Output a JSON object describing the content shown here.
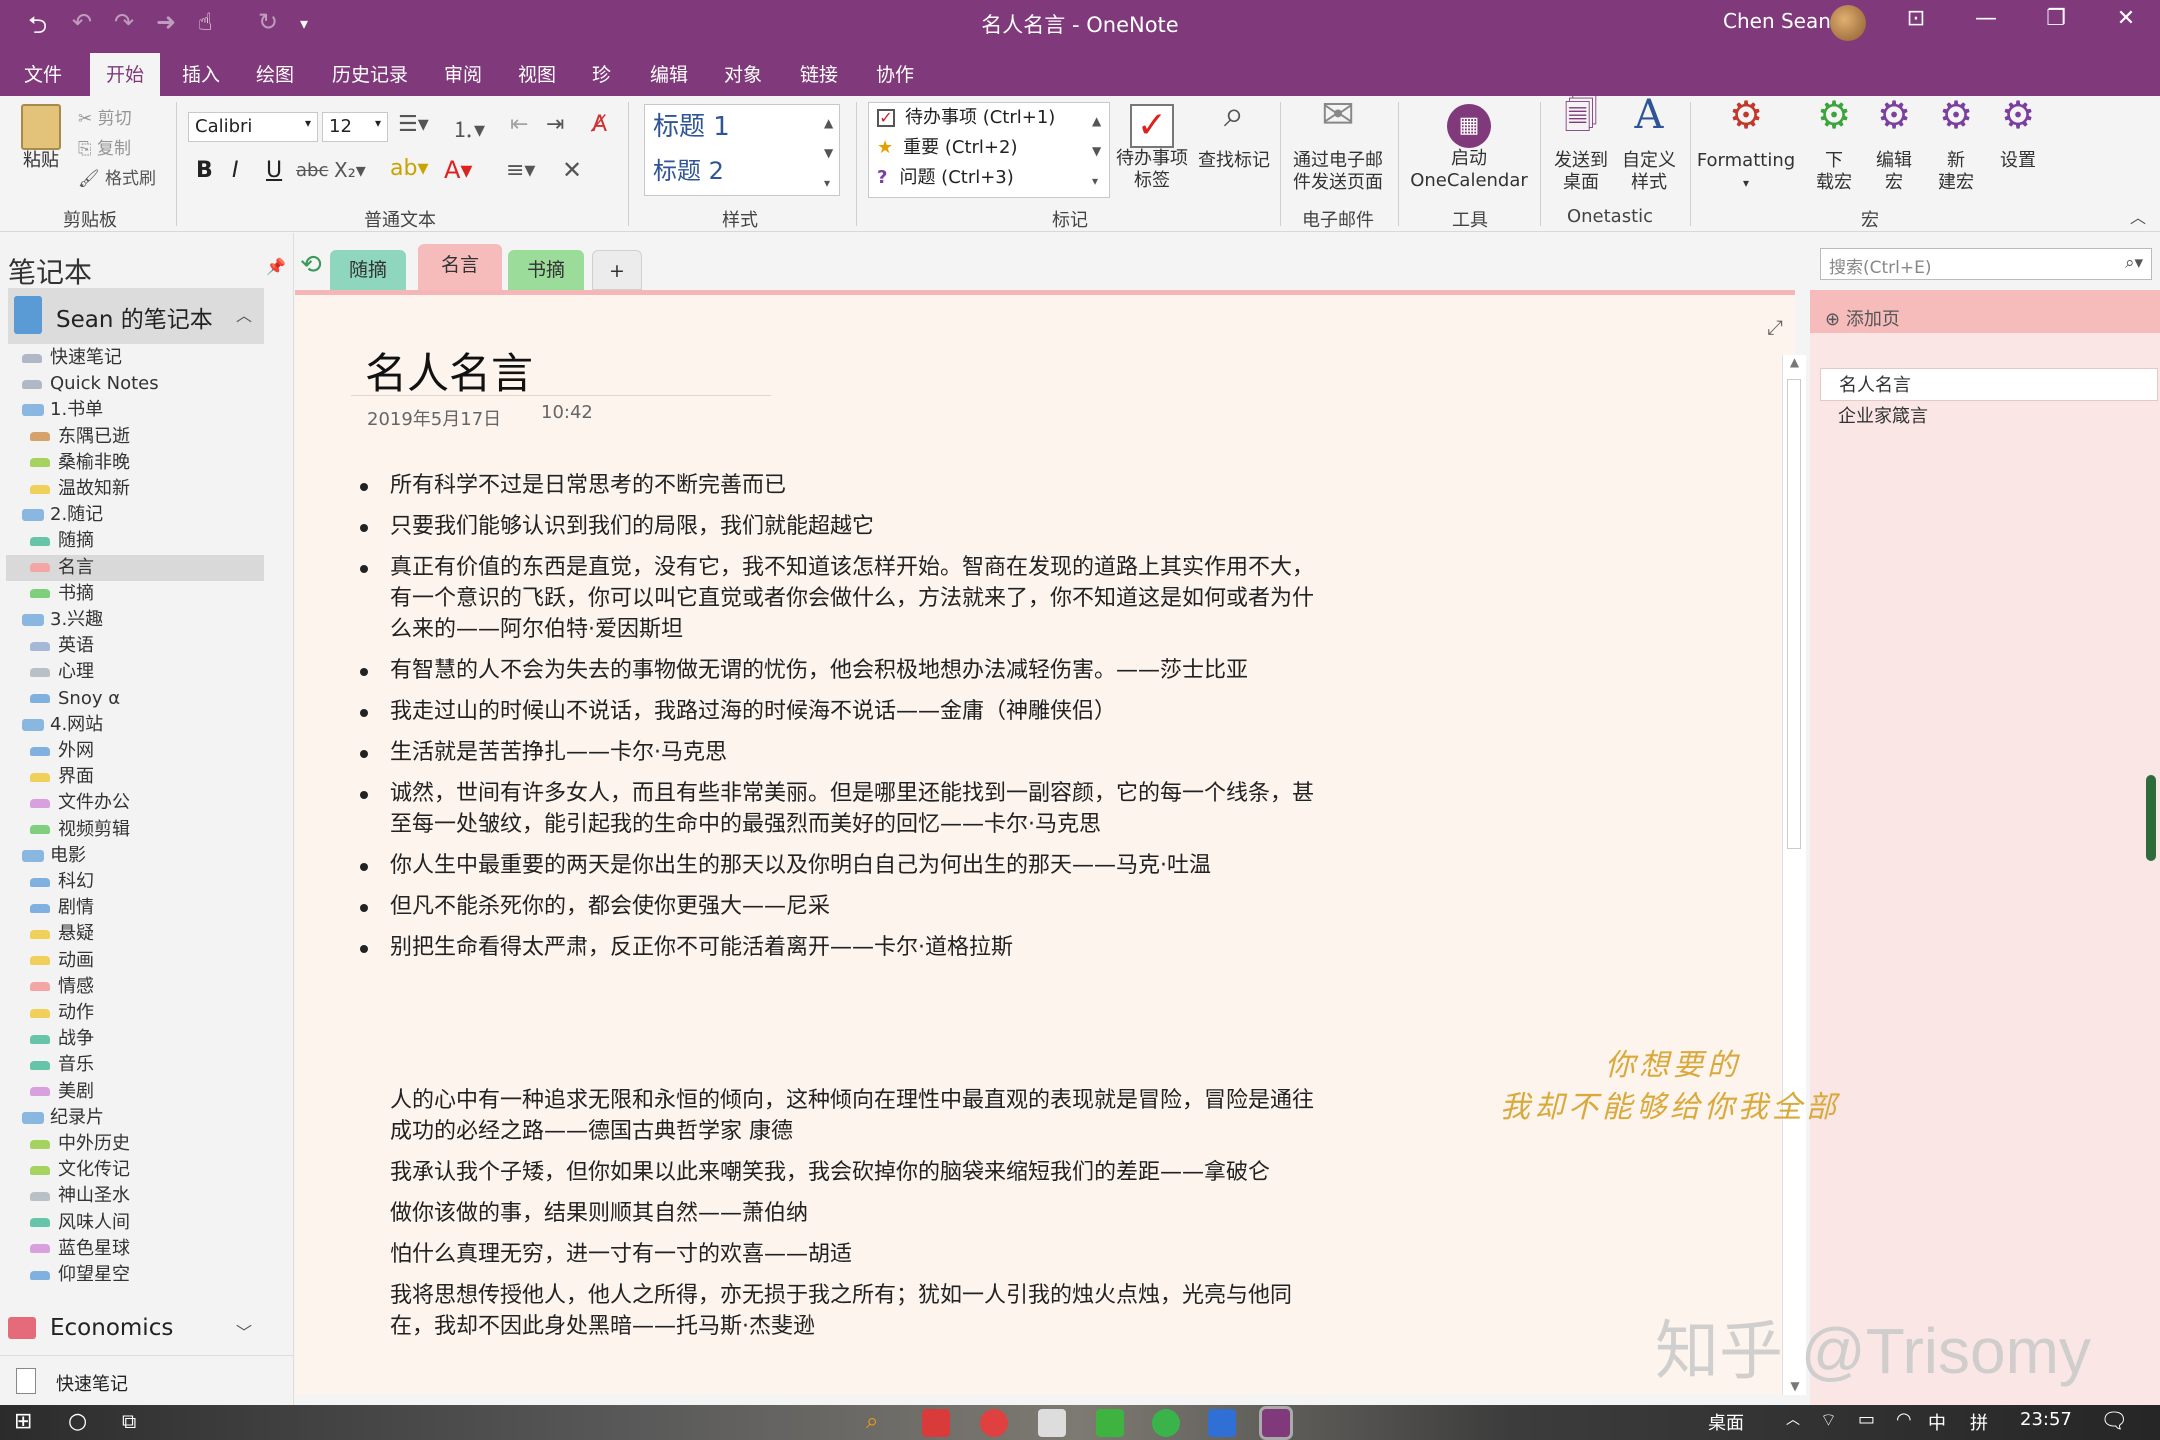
{
  "window": {
    "title": "名人名言 - OneNote",
    "user": "Chen Sean"
  },
  "menu": {
    "tabs": [
      "文件",
      "开始",
      "插入",
      "绘图",
      "历史记录",
      "审阅",
      "视图",
      "珍",
      "编辑",
      "对象",
      "链接",
      "协作"
    ],
    "active": "开始"
  },
  "ribbon": {
    "clipboard": {
      "paste": "粘贴",
      "cut": "剪切",
      "copy": "复制",
      "format_painter": "格式刷",
      "group": "剪贴板"
    },
    "basic_text": {
      "font": "Calibri",
      "size": "12",
      "group": "普通文本"
    },
    "styles": {
      "h1": "标题 1",
      "h2": "标题 2",
      "group": "样式"
    },
    "tags": {
      "todo": "待办事项 (Ctrl+1)",
      "important": "重要 (Ctrl+2)",
      "question": "问题 (Ctrl+3)",
      "todo_tag": "待办事项\n标签",
      "find_tags": "查找标记",
      "group": "标记"
    },
    "email": {
      "send": "通过电子邮\n件发送页面",
      "group": "电子邮件"
    },
    "tools": {
      "calendar": "启动\nOneCalendar",
      "group": "工具"
    },
    "onetastic": {
      "send_desktop": "发送到\n桌面",
      "custom_styles": "自定义\n样式",
      "group": "Onetastic"
    },
    "macros": {
      "formatting": "Formatting",
      "download": "下\n载宏",
      "edit": "编辑\n宏",
      "new": "新\n建宏",
      "settings": "设置",
      "group": "宏"
    }
  },
  "nav": {
    "header": "笔记本",
    "notebook": "Sean 的笔记本",
    "sections": [
      {
        "label": "快速笔记",
        "color": "#b0b8c8",
        "indent": 1,
        "group": false
      },
      {
        "label": "Quick Notes",
        "color": "#b0b8c8",
        "indent": 1,
        "group": false
      },
      {
        "label": "1.书单",
        "color": "",
        "indent": 0,
        "group": true
      },
      {
        "label": "东隅已逝",
        "color": "#d6a26a",
        "indent": 2,
        "group": false
      },
      {
        "label": "桑榆非晚",
        "color": "#a6d25f",
        "indent": 2,
        "group": false
      },
      {
        "label": "温故知新",
        "color": "#f0d05a",
        "indent": 2,
        "group": false
      },
      {
        "label": "2.随记",
        "color": "",
        "indent": 0,
        "group": true
      },
      {
        "label": "随摘",
        "color": "#66c4a8",
        "indent": 2,
        "group": false
      },
      {
        "label": "名言",
        "color": "#f4a6a6",
        "indent": 2,
        "group": false,
        "selected": true
      },
      {
        "label": "书摘",
        "color": "#7fcf7f",
        "indent": 2,
        "group": false
      },
      {
        "label": "3.兴趣",
        "color": "",
        "indent": 0,
        "group": true
      },
      {
        "label": "英语",
        "color": "#a6b8d8",
        "indent": 2,
        "group": false
      },
      {
        "label": "心理",
        "color": "#b8c0c8",
        "indent": 2,
        "group": false
      },
      {
        "label": "Snoy α",
        "color": "#7fb0e0",
        "indent": 2,
        "group": false
      },
      {
        "label": "4.网站",
        "color": "",
        "indent": 0,
        "group": true
      },
      {
        "label": "外网",
        "color": "#7fb0e0",
        "indent": 2,
        "group": false
      },
      {
        "label": "界面",
        "color": "#f0d05a",
        "indent": 2,
        "group": false
      },
      {
        "label": "文件办公",
        "color": "#d9a0e0",
        "indent": 2,
        "group": false
      },
      {
        "label": "视频剪辑",
        "color": "#7fcf7f",
        "indent": 2,
        "group": false
      },
      {
        "label": "电影",
        "color": "",
        "indent": 0,
        "group": true
      },
      {
        "label": "科幻",
        "color": "#7fb0e0",
        "indent": 2,
        "group": false
      },
      {
        "label": "剧情",
        "color": "#7fb0e0",
        "indent": 2,
        "group": false
      },
      {
        "label": "悬疑",
        "color": "#f0d05a",
        "indent": 2,
        "group": false
      },
      {
        "label": "动画",
        "color": "#f0d05a",
        "indent": 2,
        "group": false
      },
      {
        "label": "情感",
        "color": "#f4a6a6",
        "indent": 2,
        "group": false
      },
      {
        "label": "动作",
        "color": "#f0d05a",
        "indent": 2,
        "group": false
      },
      {
        "label": "战争",
        "color": "#66c4a8",
        "indent": 2,
        "group": false
      },
      {
        "label": "音乐",
        "color": "#66c4a8",
        "indent": 2,
        "group": false
      },
      {
        "label": "美剧",
        "color": "#d9a0e0",
        "indent": 2,
        "group": false
      },
      {
        "label": "纪录片",
        "color": "",
        "indent": 0,
        "group": true
      },
      {
        "label": "中外历史",
        "color": "#a6d25f",
        "indent": 2,
        "group": false
      },
      {
        "label": "文化传记",
        "color": "#a6d25f",
        "indent": 2,
        "group": false
      },
      {
        "label": "神山圣水",
        "color": "#b8c0c8",
        "indent": 2,
        "group": false
      },
      {
        "label": "风味人间",
        "color": "#66c4a8",
        "indent": 2,
        "group": false
      },
      {
        "label": "蓝色星球",
        "color": "#d9a0e0",
        "indent": 2,
        "group": false
      },
      {
        "label": "仰望星空",
        "color": "#7fb0e0",
        "indent": 2,
        "group": false
      }
    ],
    "second_notebook": "Economics",
    "quick_notes": "快速笔记"
  },
  "section_tabs": [
    {
      "label": "随摘",
      "color": "#8fd6be"
    },
    {
      "label": "名言",
      "color": "#f6bcbc",
      "active": true
    },
    {
      "label": "书摘",
      "color": "#9bdc9b"
    },
    {
      "label": "+",
      "color": "#ececec"
    }
  ],
  "page": {
    "title": "名人名言",
    "date": "2019年5月17日",
    "time": "10:42",
    "quotes_a": [
      "所有科学不过是日常思考的不断完善而已",
      "只要我们能够认识到我们的局限，我们就能超越它",
      "真正有价值的东西是直觉，没有它，我不知道该怎样开始。智商在发现的道路上其实作用不大，有一个意识的飞跃，你可以叫它直觉或者你会做什么，方法就来了，你不知道这是如何或者为什么来的——阿尔伯特·爱因斯坦",
      "有智慧的人不会为失去的事物做无谓的忧伤，他会积极地想办法减轻伤害。——莎士比亚",
      "我走过山的时候山不说话，我路过海的时候海不说话——金庸（神雕侠侣）",
      "生活就是苦苦挣扎——卡尔·马克思",
      "诚然，世间有许多女人，而且有些非常美丽。但是哪里还能找到一副容颜，它的每一个线条，甚至每一处皱纹，能引起我的生命中的最强烈而美好的回忆——卡尔·马克思",
      "你人生中最重要的两天是你出生的那天以及你明白自己为何出生的那天——马克·吐温",
      "但凡不能杀死你的，都会使你更强大——尼采",
      "别把生命看得太严肃，反正你不可能活着离开——卡尔·道格拉斯"
    ],
    "quotes_b": [
      "人的心中有一种追求无限和永恒的倾向，这种倾向在理性中最直观的表现就是冒险，冒险是通往成功的必经之路——德国古典哲学家 康德",
      "我承认我个子矮，但你如果以此来嘲笑我，我会砍掉你的脑袋来缩短我们的差距——拿破仑",
      "做你该做的事，结果则顺其自然——萧伯纳",
      "怕什么真理无穷，进一寸有一寸的欢喜——胡适",
      "我将思想传授他人，他人之所得，亦无损于我之所有；犹如一人引我的烛火点烛，光亮与他同在，我却不因此身处黑暗——托马斯·杰斐逊"
    ]
  },
  "search": {
    "placeholder": "搜索(Ctrl+E)"
  },
  "pagelist": {
    "add": "添加页",
    "pages": [
      "名人名言",
      "企业家箴言"
    ],
    "selected": "名人名言"
  },
  "watermark": {
    "line1": "你想要的",
    "line2": "我却不能够给你我全部",
    "brand": "知乎 @Trisomy"
  },
  "taskbar": {
    "desktop": "桌面",
    "ime1": "中",
    "ime2": "拼",
    "clock": "23:57"
  }
}
